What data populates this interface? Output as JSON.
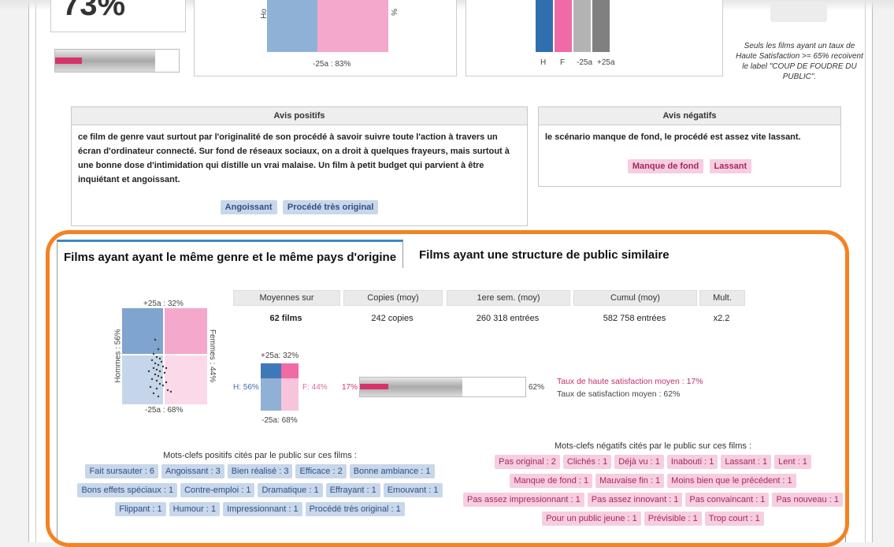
{
  "top": {
    "big_percent": "73%",
    "mid_chart_label": "-25a : 83%",
    "mid_chart_left_axis": "Ho",
    "mid_chart_right_axis": "%",
    "right_chart_labels": [
      "H",
      "F",
      "-25a",
      "+25a"
    ],
    "note": "Seuls les films ayant un taux de Haute Satisfaction >= 65% recoivent le label \"COUP DE FOUDRE DU PUBLIC\".",
    "progress_fill": 0.35
  },
  "avis_positifs": {
    "title": "Avis positifs",
    "text": "ce film de genre vaut surtout par l'originalité de son procédé à savoir suivre toute l'action à travers un écran d'ordinateur connecté. Sur fond de réseaux sociaux, on a droit à quelques frayeurs, mais surtout à une bonne dose d'intimidation qui distille un vrai malaise. Un film à petit budget qui parvient à être inquiétant et angoissant.",
    "tags": [
      "Angoissant",
      "Procédé très original"
    ]
  },
  "avis_negatifs": {
    "title": "Avis négatifs",
    "text": "le scénario manque de fond, le procédé est assez vite lassant.",
    "tags": [
      "Manque de fond",
      "Lassant"
    ]
  },
  "tabs": [
    {
      "label": "Films ayant ayant le même genre et le même pays d'origine",
      "active": true
    },
    {
      "label": "Films ayant une structure de public similaire",
      "active": false
    }
  ],
  "scatter": {
    "top_label": "+25a : 32%",
    "bottom_label": "-25a : 68%",
    "left_label": "Hommes : 56%",
    "right_label": "Femmes : 44%"
  },
  "stats": {
    "headers": [
      "Moyennes sur",
      "Copies (moy)",
      "1ere sem. (moy)",
      "Cumul (moy)",
      "Mult."
    ],
    "values": [
      "62 films",
      "242 copies",
      "260 318 entrées",
      "582 758 entrées",
      "x2.2"
    ]
  },
  "mini_chart": {
    "top": "+25a: 32%",
    "bottom": "-25a: 68%",
    "left": "H: 56%",
    "right": "F: 44%"
  },
  "satisfaction": {
    "left_label": "17%",
    "right_label": "62%",
    "high_fill": 0.17,
    "total_fill": 0.62,
    "high_text": "Taux de haute satisfaction moyen : 17%",
    "total_text": "Taux de satisfaction moyen : 62%"
  },
  "keywords_pos": {
    "title": "Mots-clefs positifs cités par le public sur ces films :",
    "rows": [
      [
        "Fait sursauter : 6",
        "Angoissant : 3",
        "Bien réalisé : 3",
        "Efficace : 2",
        "Bonne ambiance : 1"
      ],
      [
        "Bons effets spéciaux : 1",
        "Contre-emploi : 1",
        "Dramatique : 1",
        "Effrayant : 1",
        "Emouvant : 1"
      ],
      [
        "Flippant : 1",
        "Humour : 1",
        "Impressionnant : 1",
        "Procédé très original : 1"
      ]
    ]
  },
  "keywords_neg": {
    "title": "Mots-clefs négatifs cités par le public sur ces films :",
    "rows": [
      [
        "Pas original : 2",
        "Clichés : 1",
        "Déjà vu : 1",
        "Inabouti : 1",
        "Lassant : 1",
        "Lent : 1"
      ],
      [
        "Manque de fond : 1",
        "Mauvaise fin : 1",
        "Moins bien que le précédent : 1"
      ],
      [
        "Pas assez impressionnant : 1",
        "Pas assez innovant : 1",
        "Pas convaincant : 1",
        "Pas nouveau : 1"
      ],
      [
        "Pour un public jeune : 1",
        "Prévisible : 1",
        "Trop court : 1"
      ]
    ]
  },
  "colors": {
    "accent_orange": "#f58220",
    "tab_active": "#3f87c9",
    "pink": "#d6336c",
    "blue": "#8fb1d6"
  }
}
